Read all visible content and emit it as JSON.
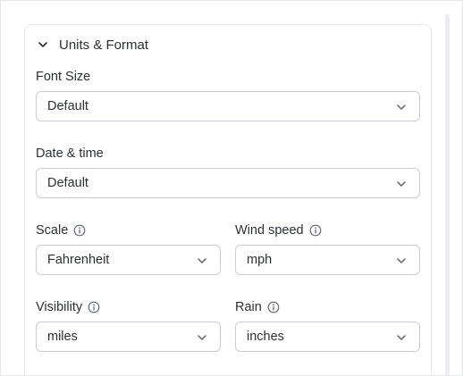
{
  "section": {
    "title": "Units & Format",
    "expanded": true,
    "icon": "chevron-down-icon"
  },
  "fields": {
    "font_size": {
      "label": "Font Size",
      "value": "Default"
    },
    "date_time": {
      "label": "Date & time",
      "value": "Default"
    },
    "scale": {
      "label": "Scale",
      "value": "Fahrenheit",
      "info_icon": "info-icon"
    },
    "wind_speed": {
      "label": "Wind speed",
      "value": "mph",
      "info_icon": "info-icon"
    },
    "visibility": {
      "label": "Visibility",
      "value": "miles",
      "info_icon": "info-icon"
    },
    "rain": {
      "label": "Rain",
      "value": "inches",
      "info_icon": "info-icon"
    }
  },
  "colors": {
    "text": "#2b2f36",
    "border": "#c8ccd2",
    "panel_border": "#e6e8eb",
    "icon": "#5b6470"
  }
}
